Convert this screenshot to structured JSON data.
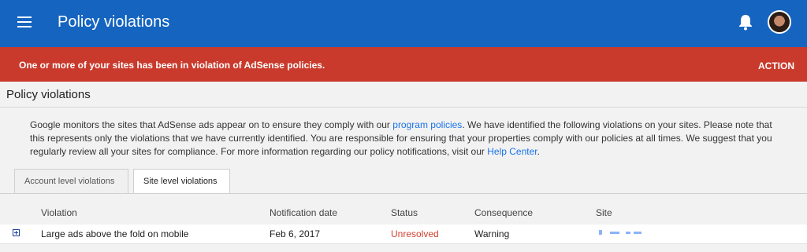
{
  "header": {
    "title": "Policy violations",
    "menu_icon": "hamburger-menu-icon",
    "notification_icon": "bell-icon",
    "avatar": "user-avatar"
  },
  "alert": {
    "message": "One or more of your sites has been in violation of AdSense policies.",
    "action_label": "ACTION",
    "color": "#c93a2c"
  },
  "section": {
    "title": "Policy violations",
    "description_part1": "Google monitors the sites that AdSense ads appear on to ensure they comply with our ",
    "program_policies_link": "program policies",
    "description_part2": ". We have identified the following violations on your sites. Please note that this represents only the violations that we have currently identified. You are responsible for ensuring that your properties comply with our policies at all times. We suggest that you regularly review all your sites for compliance. For more information regarding our policy notifications, visit our ",
    "help_center_link": "Help Center",
    "description_part3": "."
  },
  "tabs": [
    {
      "label": "Account level violations",
      "active": false
    },
    {
      "label": "Site level violations",
      "active": true
    }
  ],
  "table": {
    "columns": [
      "Violation",
      "Notification date",
      "Status",
      "Consequence",
      "Site"
    ],
    "rows": [
      {
        "violation": "Large ads above the fold on mobile",
        "notification_date": "Feb 6, 2017",
        "status": "Unresolved",
        "consequence": "Warning",
        "site": ""
      }
    ]
  },
  "colors": {
    "app_bar": "#1565c0",
    "alert": "#c93a2c",
    "link": "#1a73e8",
    "status_unresolved": "#d23f31"
  }
}
